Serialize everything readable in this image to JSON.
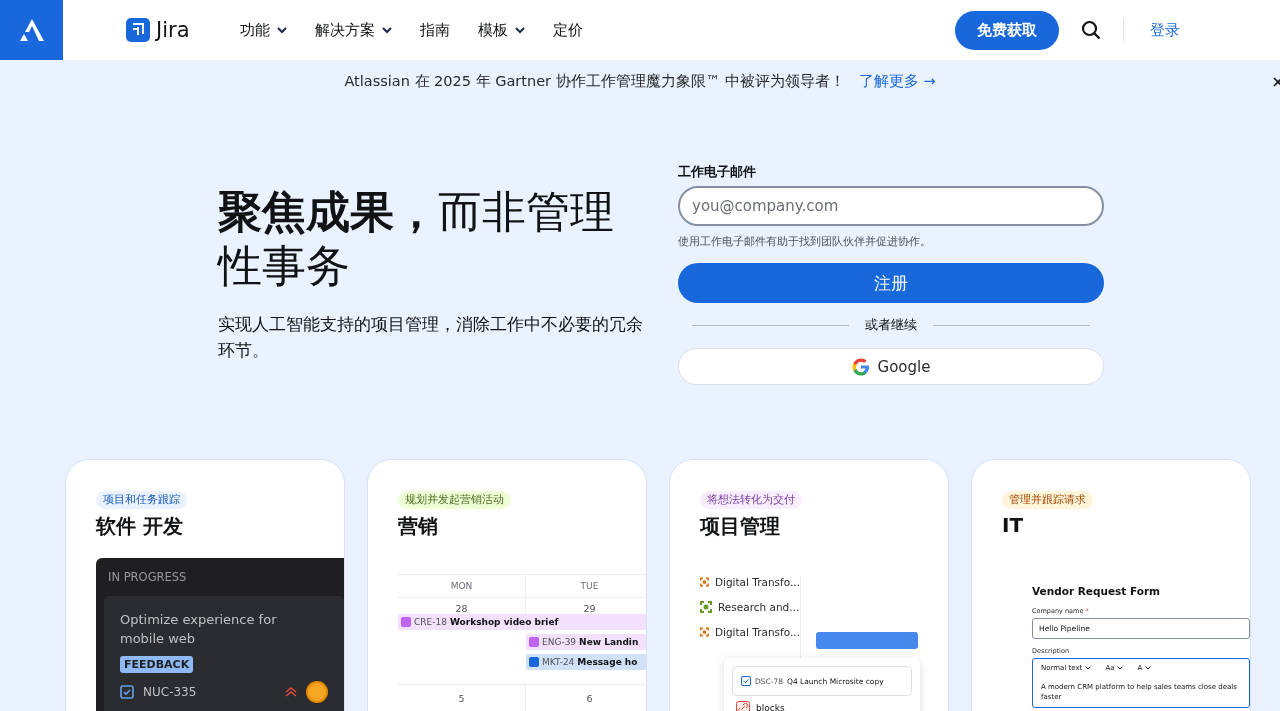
{
  "nav": {
    "product": "Jira",
    "menu": [
      {
        "label": "功能",
        "dropdown": true
      },
      {
        "label": "解决方案",
        "dropdown": true
      },
      {
        "label": "指南",
        "dropdown": false
      },
      {
        "label": "模板",
        "dropdown": true
      },
      {
        "label": "定价",
        "dropdown": false
      }
    ],
    "cta": "免费获取",
    "login": "登录"
  },
  "banner": {
    "text": "Atlassian 在 2025 年 Gartner 协作工作管理魔力象限™ 中被评为领导者！",
    "link": "了解更多 →"
  },
  "hero": {
    "title": "**聚焦成果，**而非管理性事务",
    "subtitle": "实现人工智能支持的项目管理，消除工作中不必要的冗余环节。"
  },
  "signup": {
    "label": "工作电子邮件",
    "placeholder": "you@company.com",
    "hint": "使用工作电子邮件有助于找到团队伙伴并促进协作。",
    "button": "注册",
    "divider": "或者继续",
    "google": "Google"
  },
  "cards": [
    {
      "kind": "board",
      "tag": "项目和任务跟踪",
      "color": "#e9f2fe",
      "title": "软件 开发",
      "column": "IN PROGRESS",
      "issue_title": "Optimize experience for mobile web",
      "label": "FEEDBACK",
      "issue_key": "NUC-335"
    },
    {
      "kind": "calendar",
      "tag": "规划并发起营销活动",
      "color": "#efffd6",
      "title": "营销",
      "days": [
        "MON",
        "TUE"
      ],
      "dates": [
        {
          "label": "28",
          "events": [
            {
              "key": "CRE-18",
              "title": "Workshop video brief",
              "color": "#bf63f3"
            }
          ]
        },
        {
          "label": "29",
          "events": [
            {
              "key": "ENG-39",
              "title": "New Landin",
              "color": "#bf63f3"
            },
            {
              "key": "MKT-24",
              "title": "Message ho",
              "color": "#1868db"
            }
          ]
        }
      ],
      "next_dates": [
        "5",
        "6"
      ]
    },
    {
      "kind": "timeline",
      "tag": "将想法转化为交付",
      "color": "#f8eefe",
      "title": "项目管理",
      "rows": [
        {
          "label": "Digital Transfo...",
          "color": "#e06c00"
        },
        {
          "label": "Research and...",
          "color": "#6a9a23"
        },
        {
          "label": "Digital Transfo...",
          "color": "#e06c00"
        }
      ],
      "popup_key": "DSC-78",
      "popup_title": "Q4 Launch Microsite copy",
      "link_type": "blocks"
    },
    {
      "kind": "form",
      "tag": "管理并跟踪请求",
      "color": "#fff5db",
      "title": "IT",
      "form_title": "Vendor Request Form",
      "field_label": "Company name",
      "required": "*",
      "field_value": "Hello Pipeline",
      "desc_label": "Description",
      "toolbar": [
        "Normal text",
        "Aa",
        "A"
      ],
      "desc_text": "A modern CRM platform to help sales teams close deals faster"
    }
  ]
}
